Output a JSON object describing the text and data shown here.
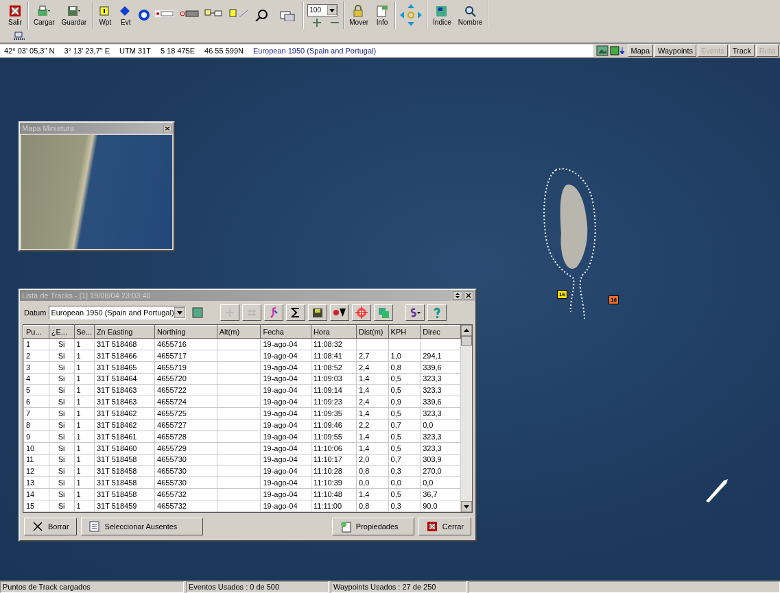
{
  "toolbar": {
    "items": [
      {
        "kind": "exit",
        "label": "Salir"
      },
      {
        "kind": "load",
        "label": "Cargar"
      },
      {
        "kind": "save",
        "label": "Guardar"
      },
      {
        "kind": "wpt",
        "label": "Wpt"
      },
      {
        "kind": "evt",
        "label": "Evt"
      },
      {
        "kind": "misc"
      },
      {
        "kind": "zoom",
        "value": "100"
      },
      {
        "kind": "move",
        "label": "Mover"
      },
      {
        "kind": "info",
        "label": "Info"
      },
      {
        "kind": "arrows"
      },
      {
        "kind": "index",
        "label": "Índice"
      },
      {
        "kind": "name",
        "label": "Nombre"
      }
    ]
  },
  "coordinates": {
    "latitude": "42° 03' 05,3\" N",
    "longitude": "3° 13' 23,7\" E",
    "utm": "UTM  31T",
    "easting": "5 18 475E",
    "northing": "46 55 599N",
    "datum": "European 1950 (Spain and Portugal)"
  },
  "view_tabs": [
    {
      "label": "Mapa",
      "disabled": false
    },
    {
      "label": "Waypoints",
      "disabled": false
    },
    {
      "label": "Events",
      "disabled": true
    },
    {
      "label": "Track",
      "disabled": false
    },
    {
      "label": "Ruta",
      "disabled": true
    }
  ],
  "map": {
    "markers": [
      {
        "label": "16",
        "color": "#f2e000"
      },
      {
        "label": "18",
        "color": "#e8702a"
      }
    ]
  },
  "mini_map": {
    "title": "Mapa Miniatura"
  },
  "track_list": {
    "title": "Lista de Tracks - [1] 19/08/04 23:03:40",
    "datum_label": "Datum",
    "datum": "European 1950 (Spain and Portugal)",
    "columns": [
      "Pu...",
      "¿E...",
      "Se...",
      "Zn  Easting",
      "Northing",
      "Alt(m)",
      "Fecha",
      "Hora",
      "Dist(m)",
      "KPH",
      "Direc"
    ],
    "rows": [
      [
        "1",
        "Si",
        "1",
        "31T  518468",
        "4655716",
        "",
        "19-ago-04",
        "11:08:32",
        "",
        "",
        ""
      ],
      [
        "2",
        "Si",
        "1",
        "31T  518466",
        "4655717",
        "",
        "19-ago-04",
        "11:08:41",
        "2,7",
        "1,0",
        "294,1"
      ],
      [
        "3",
        "Si",
        "1",
        "31T  518465",
        "4655719",
        "",
        "19-ago-04",
        "11:08:52",
        "2,4",
        "0,8",
        "339,6"
      ],
      [
        "4",
        "Si",
        "1",
        "31T  518464",
        "4655720",
        "",
        "19-ago-04",
        "11:09:03",
        "1,4",
        "0,5",
        "323,3"
      ],
      [
        "5",
        "Si",
        "1",
        "31T  518463",
        "4655722",
        "",
        "19-ago-04",
        "11:09:14",
        "1,4",
        "0,5",
        "323,3"
      ],
      [
        "6",
        "Si",
        "1",
        "31T  518463",
        "4655724",
        "",
        "19-ago-04",
        "11:09:23",
        "2,4",
        "0,9",
        "339,6"
      ],
      [
        "7",
        "Si",
        "1",
        "31T  518462",
        "4655725",
        "",
        "19-ago-04",
        "11:09:35",
        "1,4",
        "0,5",
        "323,3"
      ],
      [
        "8",
        "Si",
        "1",
        "31T  518462",
        "4655727",
        "",
        "19-ago-04",
        "11:09:46",
        "2,2",
        "0,7",
        "0,0"
      ],
      [
        "9",
        "Si",
        "1",
        "31T  518461",
        "4655728",
        "",
        "19-ago-04",
        "11:09:55",
        "1,4",
        "0,5",
        "323,3"
      ],
      [
        "10",
        "Si",
        "1",
        "31T  518460",
        "4655729",
        "",
        "19-ago-04",
        "11:10:06",
        "1,4",
        "0,5",
        "323,3"
      ],
      [
        "11",
        "Si",
        "1",
        "31T  518458",
        "4655730",
        "",
        "19-ago-04",
        "11:10:17",
        "2,0",
        "0,7",
        "303,9"
      ],
      [
        "12",
        "Si",
        "1",
        "31T  518458",
        "4655730",
        "",
        "19-ago-04",
        "11:10:28",
        "0,8",
        "0,3",
        "270,0"
      ],
      [
        "13",
        "Si",
        "1",
        "31T  518458",
        "4655730",
        "",
        "19-ago-04",
        "11:10:39",
        "0,0",
        "0,0",
        "0,0"
      ],
      [
        "14",
        "Si",
        "1",
        "31T  518458",
        "4655732",
        "",
        "19-ago-04",
        "11:10:48",
        "1,4",
        "0,5",
        "36,7"
      ],
      [
        "15",
        "Si",
        "1",
        "31T  518459",
        "4655732",
        "",
        "19-ago-04",
        "11:11:00",
        "0.8",
        "0,3",
        "90.0"
      ]
    ],
    "buttons": [
      {
        "kind": "delete",
        "label": "Borrar"
      },
      {
        "kind": "select",
        "label": "Seleccionar Ausentes"
      },
      {
        "kind": "props",
        "label": "Propiedades"
      },
      {
        "kind": "close",
        "label": "Cerrar"
      }
    ]
  },
  "status_bar": [
    "Puntos de Track cargados",
    "Eventos Usados : 0 de 500",
    "Waypoints Usados : 27 de 250"
  ]
}
